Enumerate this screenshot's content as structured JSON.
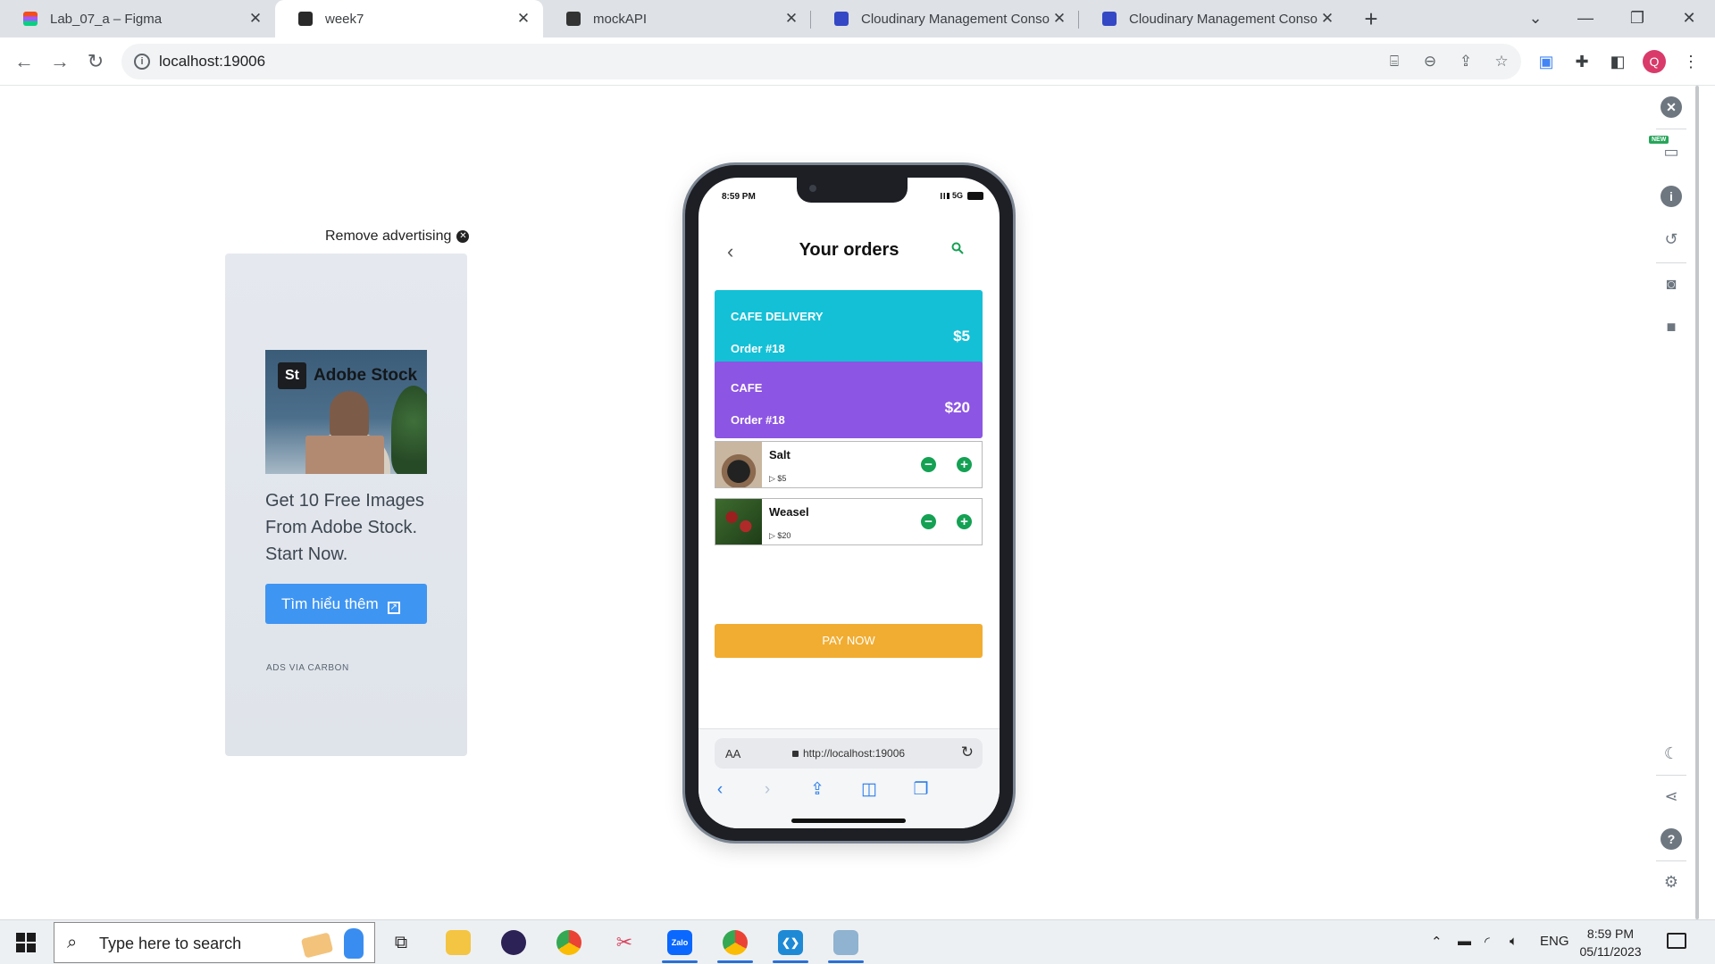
{
  "browser": {
    "tabs": [
      {
        "title": "Lab_07_a – Figma",
        "active": false,
        "icon": "figma-icon"
      },
      {
        "title": "week7",
        "active": true,
        "icon": "expo-icon"
      },
      {
        "title": "mockAPI",
        "active": false,
        "icon": "mockapi-icon"
      },
      {
        "title": "Cloudinary Management Conso",
        "active": false,
        "icon": "cloudinary-icon"
      },
      {
        "title": "Cloudinary Management Conso",
        "active": false,
        "icon": "cloudinary-icon"
      }
    ],
    "url": "localhost:19006",
    "profile_initial": "Q"
  },
  "ad": {
    "remove_label": "Remove advertising",
    "image_logo_badge": "St",
    "image_brand": "Adobe Stock",
    "text": "Get 10 Free Images From Adobe Stock. Start Now.",
    "button_label": "Tìm hiểu thêm",
    "via": "ADS VIA CARBON"
  },
  "phone": {
    "status_time": "8:59 PM",
    "network": "5G",
    "title": "Your orders",
    "orders": [
      {
        "name": "CAFE DELIVERY",
        "number": "Order #18",
        "price": "$5",
        "color": "#14c0d6"
      },
      {
        "name": "CAFE",
        "number": "Order #18",
        "price": "$20",
        "color": "#8d55e3"
      }
    ],
    "items": [
      {
        "name": "Salt",
        "price": "▷ $5"
      },
      {
        "name": "Weasel",
        "price": "▷ $20"
      }
    ],
    "pay_label": "PAY NOW",
    "safari": {
      "aa": "AA",
      "address": "http://localhost:19006"
    }
  },
  "sidebar": {
    "new_badge": "NEW"
  },
  "taskbar": {
    "search_placeholder": "Type here to search",
    "language": "ENG",
    "time": "8:59 PM",
    "date": "05/11/2023"
  },
  "colors": {
    "accent_green": "#14a153",
    "pay_button": "#f1ad31",
    "ad_button": "#3f95f2"
  }
}
